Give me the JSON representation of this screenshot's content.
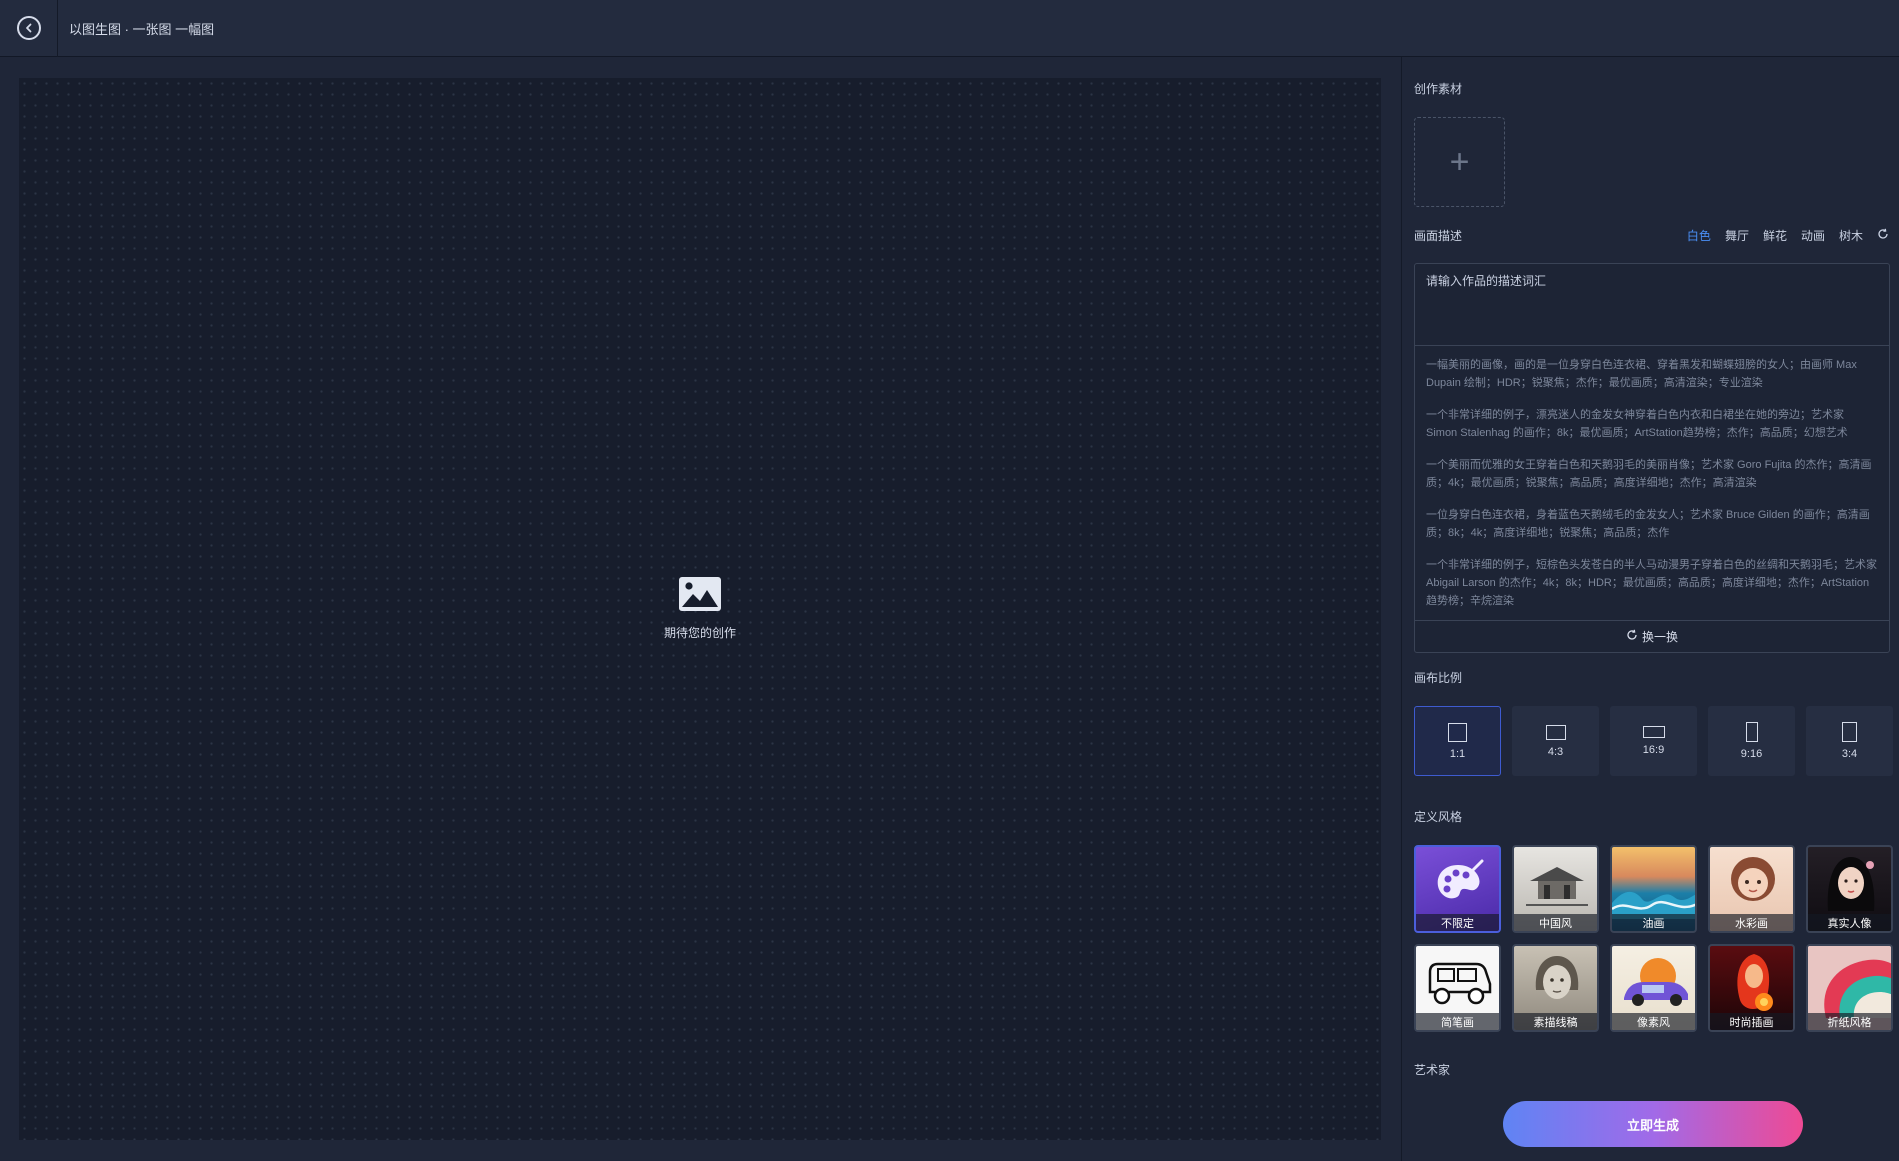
{
  "header": {
    "title": "以图生图 · 一张图 一幅图",
    "back_icon": "back-arrow-icon"
  },
  "canvas": {
    "placeholder_text": "期待您的创作",
    "placeholder_icon": "image-icon"
  },
  "panel": {
    "material_title": "创作素材",
    "description_title": "画面描述",
    "tags": [
      "白色",
      "舞厅",
      "鲜花",
      "动画",
      "树木"
    ],
    "active_tag": "白色",
    "input_placeholder": "请输入作品的描述词汇",
    "suggestions": [
      "一幅美丽的画像，画的是一位身穿白色连衣裙、穿着黑发和蝴蝶翅膀的女人；由画师 Max Dupain 绘制；HDR；锐聚焦；杰作；最优画质；高清渲染；专业渲染",
      "一个非常详细的例子，漂亮迷人的金发女神穿着白色内衣和白裙坐在她的旁边；艺术家 Simon Stalenhag 的画作；8k；最优画质；ArtStation趋势榜；杰作；高品质；幻想艺术",
      "一个美丽而优雅的女王穿着白色和天鹅羽毛的美丽肖像；艺术家 Goro Fujita 的杰作；高清画质；4k；最优画质；锐聚焦；高品质；高度详细地；杰作；高清渲染",
      "一位身穿白色连衣裙，身着蓝色天鹅绒毛的金发女人；艺术家 Bruce Gilden 的画作；高清画质；8k；4k；高度详细地；锐聚焦；高品质；杰作",
      "一个非常详细的例子，短棕色头发苍白的半人马动漫男子穿着白色的丝绸和天鹅羽毛；艺术家 Abigail Larson 的杰作；4k；8k；HDR；最优画质；高品质；高度详细地；杰作；ArtStation趋势榜；辛烷渲染"
    ],
    "refresh_label": "换一换",
    "ratio_title": "画布比例",
    "ratios": [
      "1:1",
      "4:3",
      "16:9",
      "9:16",
      "3:4"
    ],
    "active_ratio": "1:1",
    "style_title": "定义风格",
    "styles": [
      "不限定",
      "中国风",
      "油画",
      "水彩画",
      "真实人像",
      "简笔画",
      "素描线稿",
      "像素风",
      "时尚插画",
      "折纸风格"
    ],
    "active_style": "不限定",
    "artist_title": "艺术家",
    "generate_label": "立即生成"
  },
  "colors": {
    "accent": "#4a8ff5",
    "background": "#1f2638",
    "canvas": "#171d2c"
  }
}
